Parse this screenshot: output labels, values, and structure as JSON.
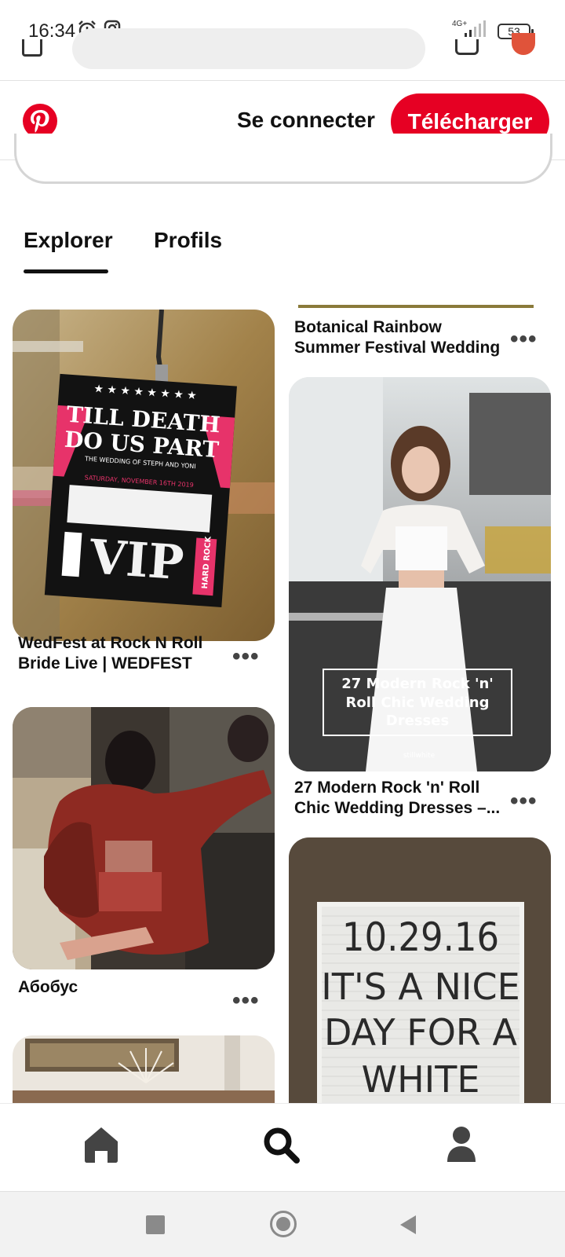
{
  "status_bar": {
    "time": "16:34",
    "network": "4G+",
    "battery": "53"
  },
  "header": {
    "connect_label": "Se connecter",
    "download_label": "Télécharger"
  },
  "tabs": [
    {
      "label": "Explorer",
      "active": true
    },
    {
      "label": "Profils",
      "active": false
    }
  ],
  "feed": {
    "left": [
      {
        "title_line1": "WedFest at Rock N Roll",
        "title_line2": "Bride Live | WEDFEST",
        "image_text": {
          "line1": "TILL DEATH",
          "line2": "DO US PART",
          "sub1": "THE WEDDING OF STEPH AND YONI",
          "sub2": "SATURDAY, NOVEMBER 16TH 2019",
          "vip": "VIP",
          "side": "HARD ROCK"
        }
      },
      {
        "title_line1": "Абобус",
        "title_line2": ""
      },
      {
        "title_line1": "",
        "title_line2": ""
      }
    ],
    "right": [
      {
        "title_line1": "Botanical Rainbow",
        "title_line2": "Summer Festival Wedding"
      },
      {
        "title_line1": "27 Modern Rock 'n' Roll",
        "title_line2": "Chic Wedding Dresses –...",
        "image_text": {
          "line1": "27 Modern Rock 'n'",
          "line2": "Roll Chic Wedding",
          "line3": "Dresses",
          "brand": "stillwhite"
        }
      },
      {
        "title_line1": "",
        "title_line2": "",
        "image_text": {
          "line1": "10.29.16",
          "line2": "IT'S A NICE",
          "line3": "DAY FOR A",
          "line4": "WHITE"
        }
      }
    ],
    "more_symbol": "•••"
  },
  "bottom_nav": {
    "items": [
      "home-icon",
      "search-icon",
      "profile-icon"
    ],
    "active": "search-icon"
  },
  "colors": {
    "brand": "#e60023",
    "text": "#111111"
  }
}
